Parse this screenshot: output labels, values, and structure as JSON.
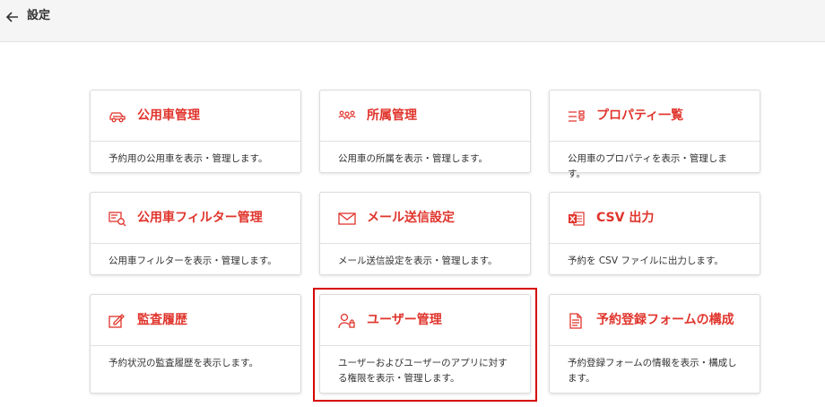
{
  "header": {
    "title": "設定",
    "back_icon": "arrow-left-icon"
  },
  "accent_color": "#e0342c",
  "highlight_color": "#d60000",
  "cards": [
    {
      "title": "公用車管理",
      "desc": "予約用の公用車を表示・管理します。",
      "icon": "car-icon"
    },
    {
      "title": "所属管理",
      "desc": "公用車の所属を表示・管理します。",
      "icon": "group-icon"
    },
    {
      "title": "プロパティ一覧",
      "desc": "公用車のプロパティを表示・管理します。",
      "icon": "list-icon"
    },
    {
      "title": "公用車フィルター管理",
      "desc": "公用車フィルターを表示・管理します。",
      "icon": "filter-search-icon"
    },
    {
      "title": "メール送信設定",
      "desc": "メール送信設定を表示・管理します。",
      "icon": "mail-icon"
    },
    {
      "title": "CSV 出力",
      "desc": "予約を CSV ファイルに出力します。",
      "icon": "excel-icon"
    },
    {
      "title": "監査履歴",
      "desc": "予約状況の監査履歴を表示します。",
      "icon": "edit-icon"
    },
    {
      "title": "ユーザー管理",
      "desc": "ユーザーおよびユーザーのアプリに対する権限を表示・管理します。",
      "icon": "user-lock-icon"
    },
    {
      "title": "予約登録フォームの構成",
      "desc": "予約登録フォームの情報を表示・構成します。",
      "icon": "document-icon"
    }
  ]
}
